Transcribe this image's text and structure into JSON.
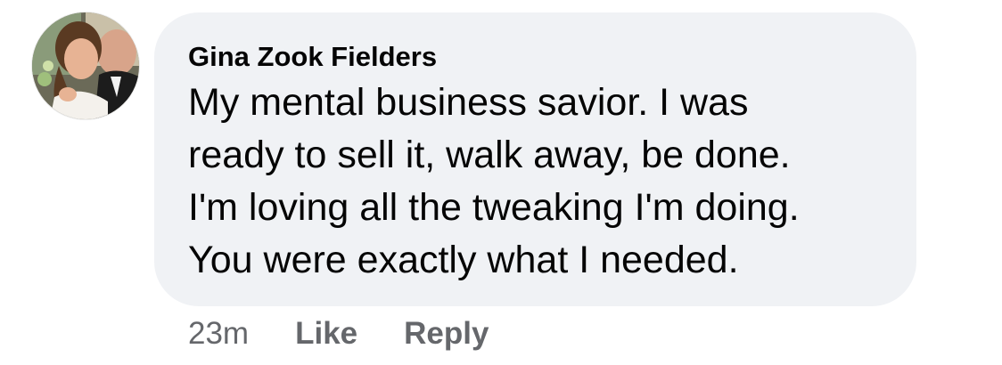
{
  "comment": {
    "avatar_icon": "profile-photo",
    "author": "Gina Zook Fielders",
    "text": "My mental business savior.  I  was\nready to sell it, walk away,  be done.\nI'm loving all the tweaking I'm doing.\nYou were exactly what I  needed.",
    "timestamp": "23m",
    "like_label": "Like",
    "reply_label": "Reply"
  },
  "colors": {
    "bubble_background": "#f0f2f5",
    "text_primary": "#050505",
    "text_secondary": "#65676b"
  }
}
